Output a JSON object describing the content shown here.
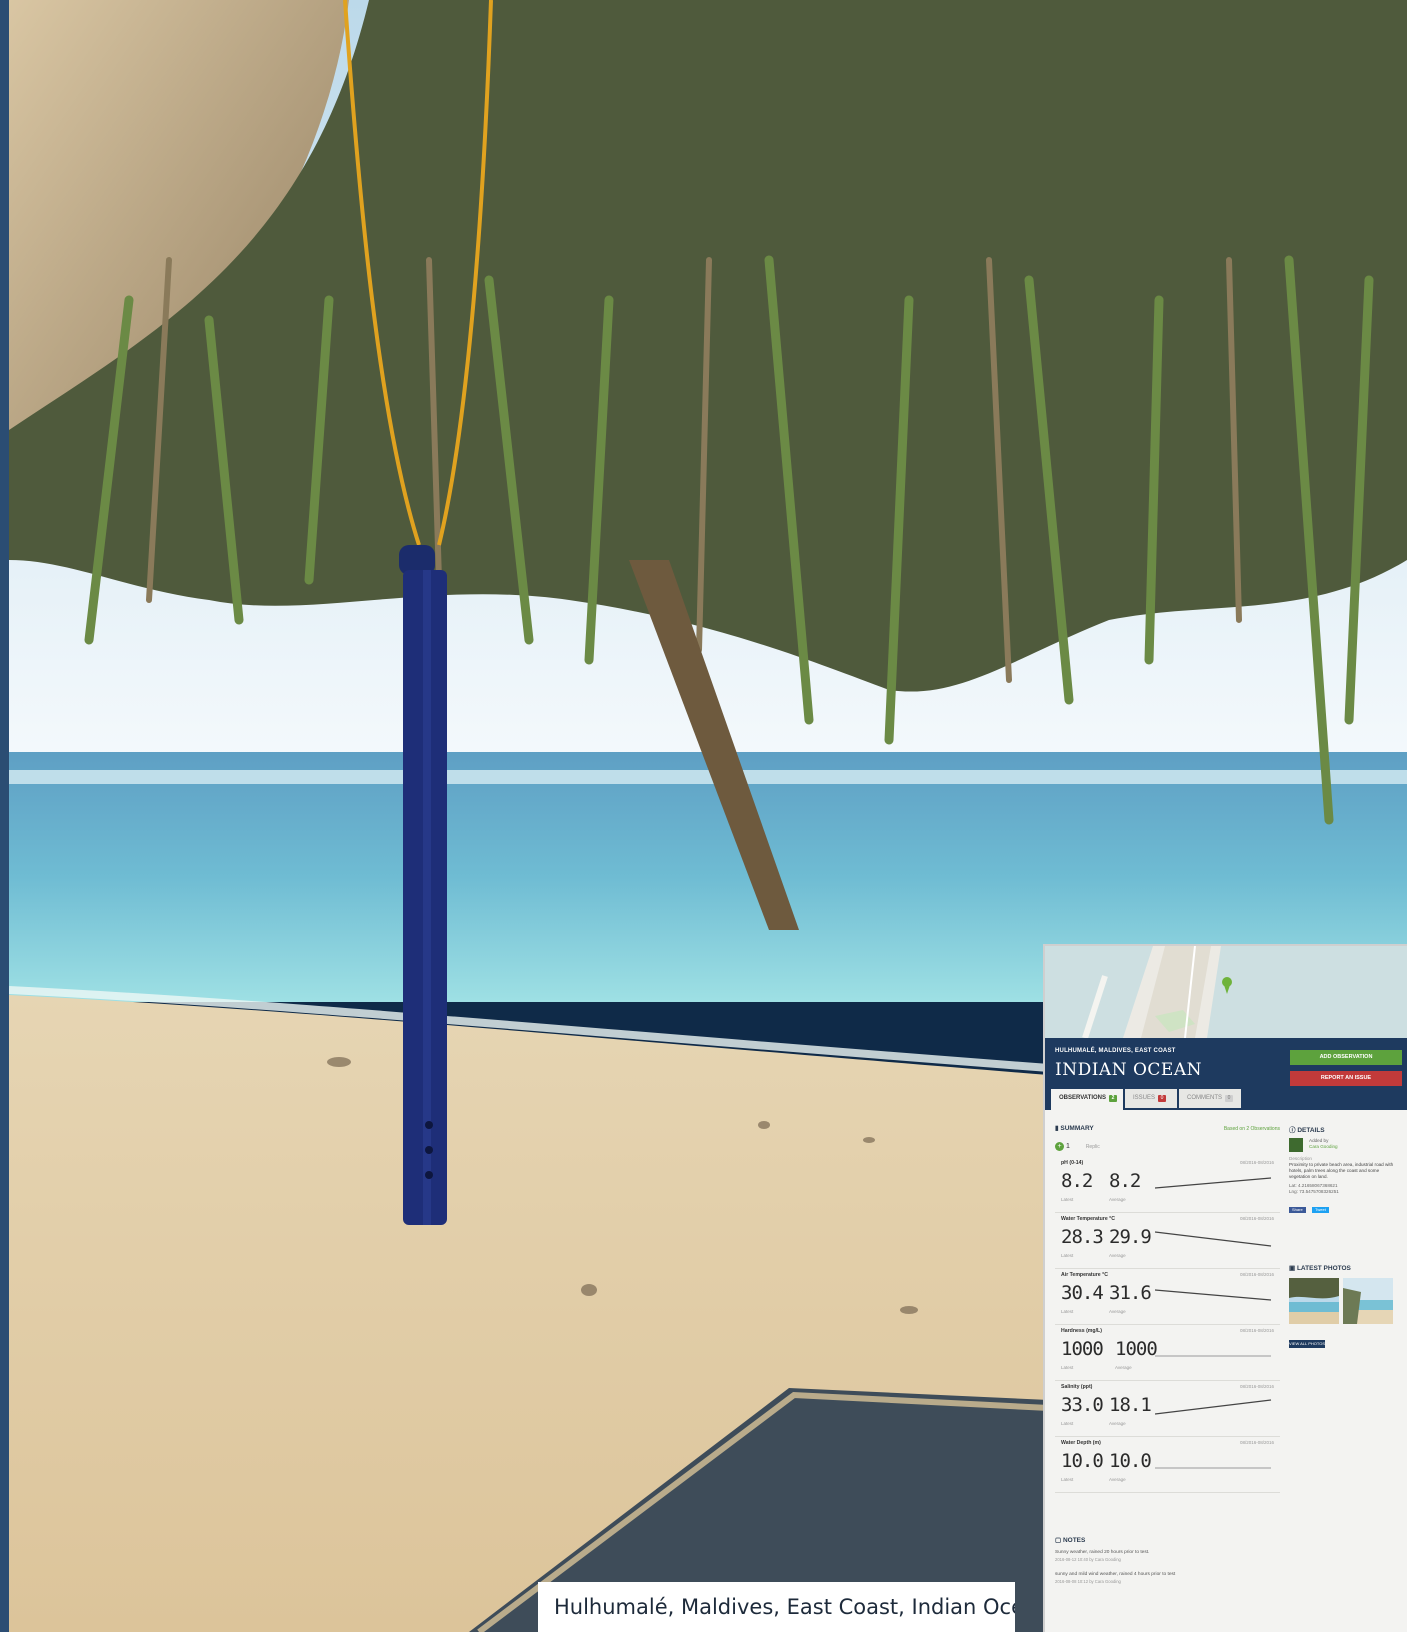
{
  "caption": "Hulhumalé, Maldives, East Coast, Indian Ocean",
  "panel": {
    "location_line": "HULHUMALÉ, MALDIVES, EAST COAST",
    "title": "INDIAN OCEAN",
    "add_button": "ADD OBSERVATION",
    "report_button": "REPORT AN ISSUE",
    "tabs": [
      {
        "label": "OBSERVATIONS",
        "count": "2"
      },
      {
        "label": "ISSUES",
        "count": "0"
      },
      {
        "label": "COMMENTS",
        "count": "0"
      }
    ],
    "summary_title": "SUMMARY",
    "based_on": "Based on 2 Observations",
    "replica_count": "1",
    "replica_label": "Replic",
    "latest_label": "Latest",
    "average_label": "Average",
    "metrics": [
      {
        "name": "pH (0-14)",
        "range": "08/2016-08/2016",
        "latest": "8.2",
        "average": "8.2",
        "trend": "up"
      },
      {
        "name": "Water Temperature °C",
        "range": "08/2016-08/2016",
        "latest": "28.3",
        "average": "29.9",
        "trend": "down"
      },
      {
        "name": "Air Temperature °C",
        "range": "08/2016-08/2016",
        "latest": "30.4",
        "average": "31.6",
        "trend": "down"
      },
      {
        "name": "Hardness (mg/L)",
        "range": "08/2016-08/2016",
        "latest": "1000",
        "average": "1000",
        "trend": "flat"
      },
      {
        "name": "Salinity (ppt)",
        "range": "08/2016-08/2016",
        "latest": "33.0",
        "average": "18.1",
        "trend": "up"
      },
      {
        "name": "Water Depth (m)",
        "range": "08/2016-08/2016",
        "latest": "10.0",
        "average": "10.0",
        "trend": "flat"
      }
    ],
    "details": {
      "title": "DETAILS",
      "added_by_label": "Added by",
      "added_by": "Cara Gooding",
      "description_label": "Description",
      "description": "Proximity to private beach area, industrial road with hotels, palm trees along the coast and some vegetation on land.",
      "lat": "Lat: 4.21658067368621",
      "lng": "Lng: 73.5475708326251",
      "share": "Share",
      "tweet": "Tweet"
    },
    "photos_title": "LATEST PHOTOS",
    "view_all": "VIEW ALL PHOTOS",
    "notes_title": "NOTES",
    "notes": [
      {
        "text": "Sunny weather, rained 20 hours prior to test.",
        "meta": "2016-08-12 10:40 by Cara Gooding"
      },
      {
        "text": "sunny and mild wind weather, rained 4 hours prior to test",
        "meta": "2016-08-08 10:12 by Cara Gooding"
      }
    ]
  }
}
